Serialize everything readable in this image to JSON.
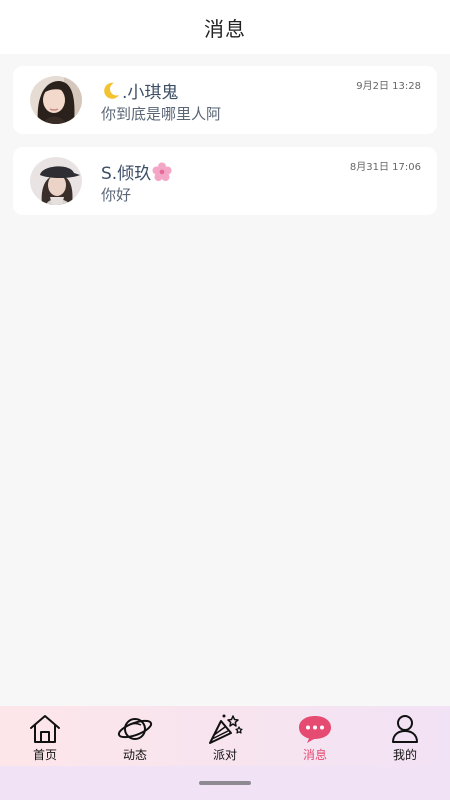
{
  "header": {
    "title": "消息"
  },
  "conversations": [
    {
      "name": ".小琪鬼",
      "name_prefix_icon": "crescent-moon-emoji",
      "message": "你到底是哪里人阿",
      "time": "9月2日 13:28",
      "avatar": "avatar-girl-long-hair"
    },
    {
      "name": "S.倾玖",
      "name_suffix_icon": "cherry-blossom-emoji",
      "message": "你好",
      "time": "8月31日 17:06",
      "avatar": "avatar-girl-cap"
    }
  ],
  "tabbar": {
    "active": "消息",
    "active_color": "#e64b72",
    "items": [
      {
        "label": "首页",
        "icon": "home-icon"
      },
      {
        "label": "动态",
        "icon": "planet-icon"
      },
      {
        "label": "派对",
        "icon": "party-icon"
      },
      {
        "label": "消息",
        "icon": "chat-bubble-icon"
      },
      {
        "label": "我的",
        "icon": "profile-icon"
      }
    ]
  }
}
